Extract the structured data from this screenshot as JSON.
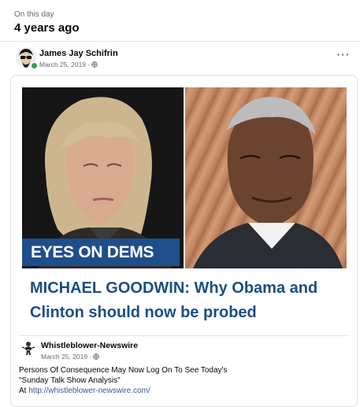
{
  "memory": {
    "label": "On this day",
    "heading": "4 years ago"
  },
  "post": {
    "author": "James Jay Schifrin",
    "date": "March 25, 2019",
    "separator": "·",
    "audience_icon": "globe-icon",
    "more_label": "···"
  },
  "shared_article": {
    "image_overlay": "EYES ON DEMS",
    "headline": "MICHAEL GOODWIN: Why Obama and Clinton should now be probed",
    "colors": {
      "banner": "#1f4e8c",
      "headline": "#1b4e86"
    }
  },
  "shared_post": {
    "page_name": "Whistleblower-Newswire",
    "date": "March 25, 2019",
    "separator": "·",
    "audience_icon": "globe-icon",
    "text_line1": "Persons Of Consequence May Now Log On To See Today's",
    "text_line2": "\"Sunday Talk Show Analysis\"",
    "text_prefix": "At",
    "link": "http://whistleblower-newswire.com/"
  }
}
